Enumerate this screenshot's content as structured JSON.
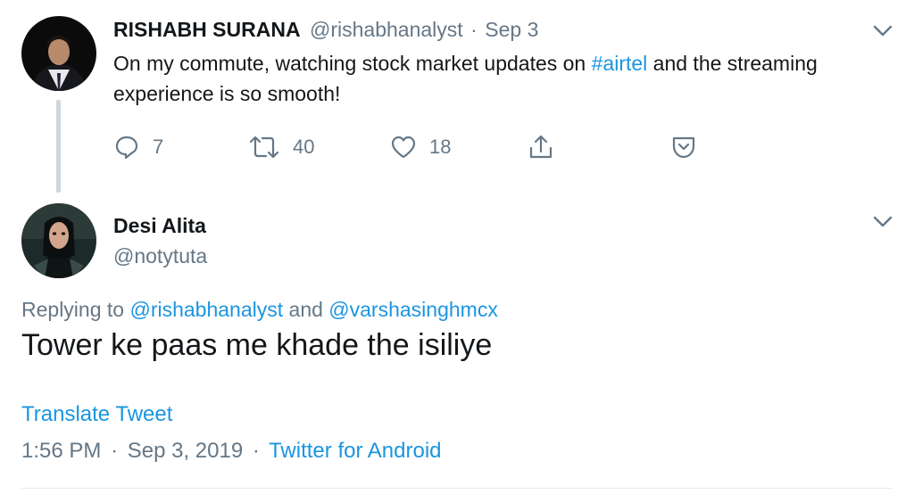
{
  "tweet1": {
    "author_name": "RISHABH SURANA",
    "author_handle": "@rishabhanalyst",
    "separator": "·",
    "date": "Sep 3",
    "text_before": "On my commute, watching stock market updates on ",
    "hashtag": "#airtel",
    "text_after": " and the streaming experience is so smooth!",
    "actions": {
      "reply_count": "7",
      "retweet_count": "40",
      "like_count": "18"
    }
  },
  "tweet2": {
    "author_name": "Desi Alita",
    "author_handle": "@notytuta",
    "replying_prefix": "Replying to ",
    "replying_user1": "@rishabhanalyst",
    "replying_and": " and ",
    "replying_user2": "@varshasinghmcx",
    "text": "Tower ke paas me khade the isiliye",
    "translate": "Translate Tweet",
    "time": "1:56 PM",
    "date": "Sep 3, 2019",
    "separator": "·",
    "source": "Twitter for Android"
  },
  "colors": {
    "link": "#1b95e0",
    "muted": "#657786",
    "text": "#14171a",
    "thread_line": "#ccd6dd"
  }
}
